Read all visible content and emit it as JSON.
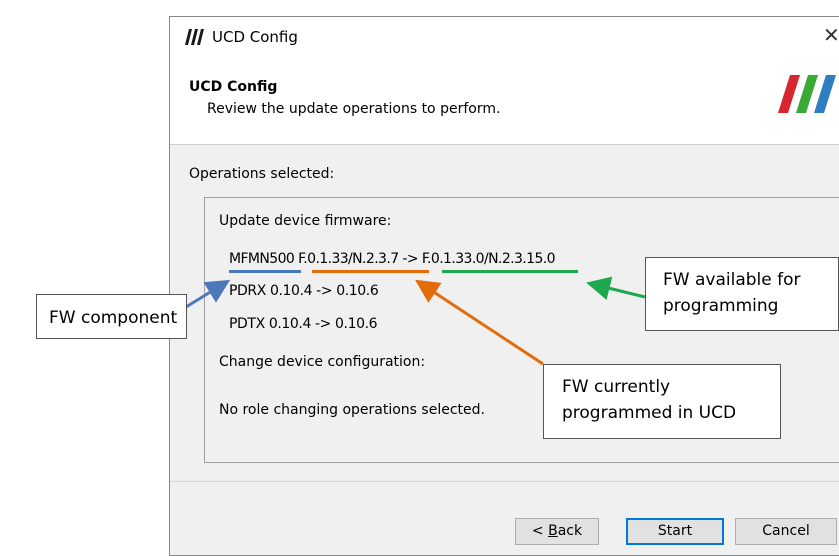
{
  "window": {
    "title": "UCD Config",
    "close_glyph": "✕",
    "icon": "ucd-logo-icon"
  },
  "header": {
    "title": "UCD Config",
    "subtitle": "Review the update operations to perform."
  },
  "operations": {
    "label": "Operations selected:",
    "firmware_heading": "Update device firmware:",
    "line1": {
      "component": "MFMN500",
      "current": "F.0.1.33/N.2.3.7",
      "arrow": "->",
      "available": "F.0.1.33.0/N.2.3.15.0"
    },
    "line2": "PDRX 0.10.4 -> 0.10.6",
    "line3": "PDTX 0.10.4 -> 0.10.6",
    "config_heading": "Change device configuration:",
    "config_text": "No role changing operations selected."
  },
  "buttons": {
    "back_label_underlined": "B",
    "back_label_prefix": "< ",
    "back_label_rest": "ack",
    "start": "Start",
    "cancel": "Cancel"
  },
  "annotations": {
    "fw_component": "FW component",
    "fw_available_line1": "FW available for",
    "fw_available_line2": "programming",
    "fw_current_line1": "FW currently",
    "fw_current_line2": "programmed in UCD"
  },
  "colors": {
    "blue": "#4a78b8",
    "orange": "#e36c0a",
    "green": "#1ea84e",
    "accent": "#0078d7",
    "logo_red": "#d7262d",
    "logo_green": "#3aa935",
    "logo_blue": "#2f7ec2"
  }
}
